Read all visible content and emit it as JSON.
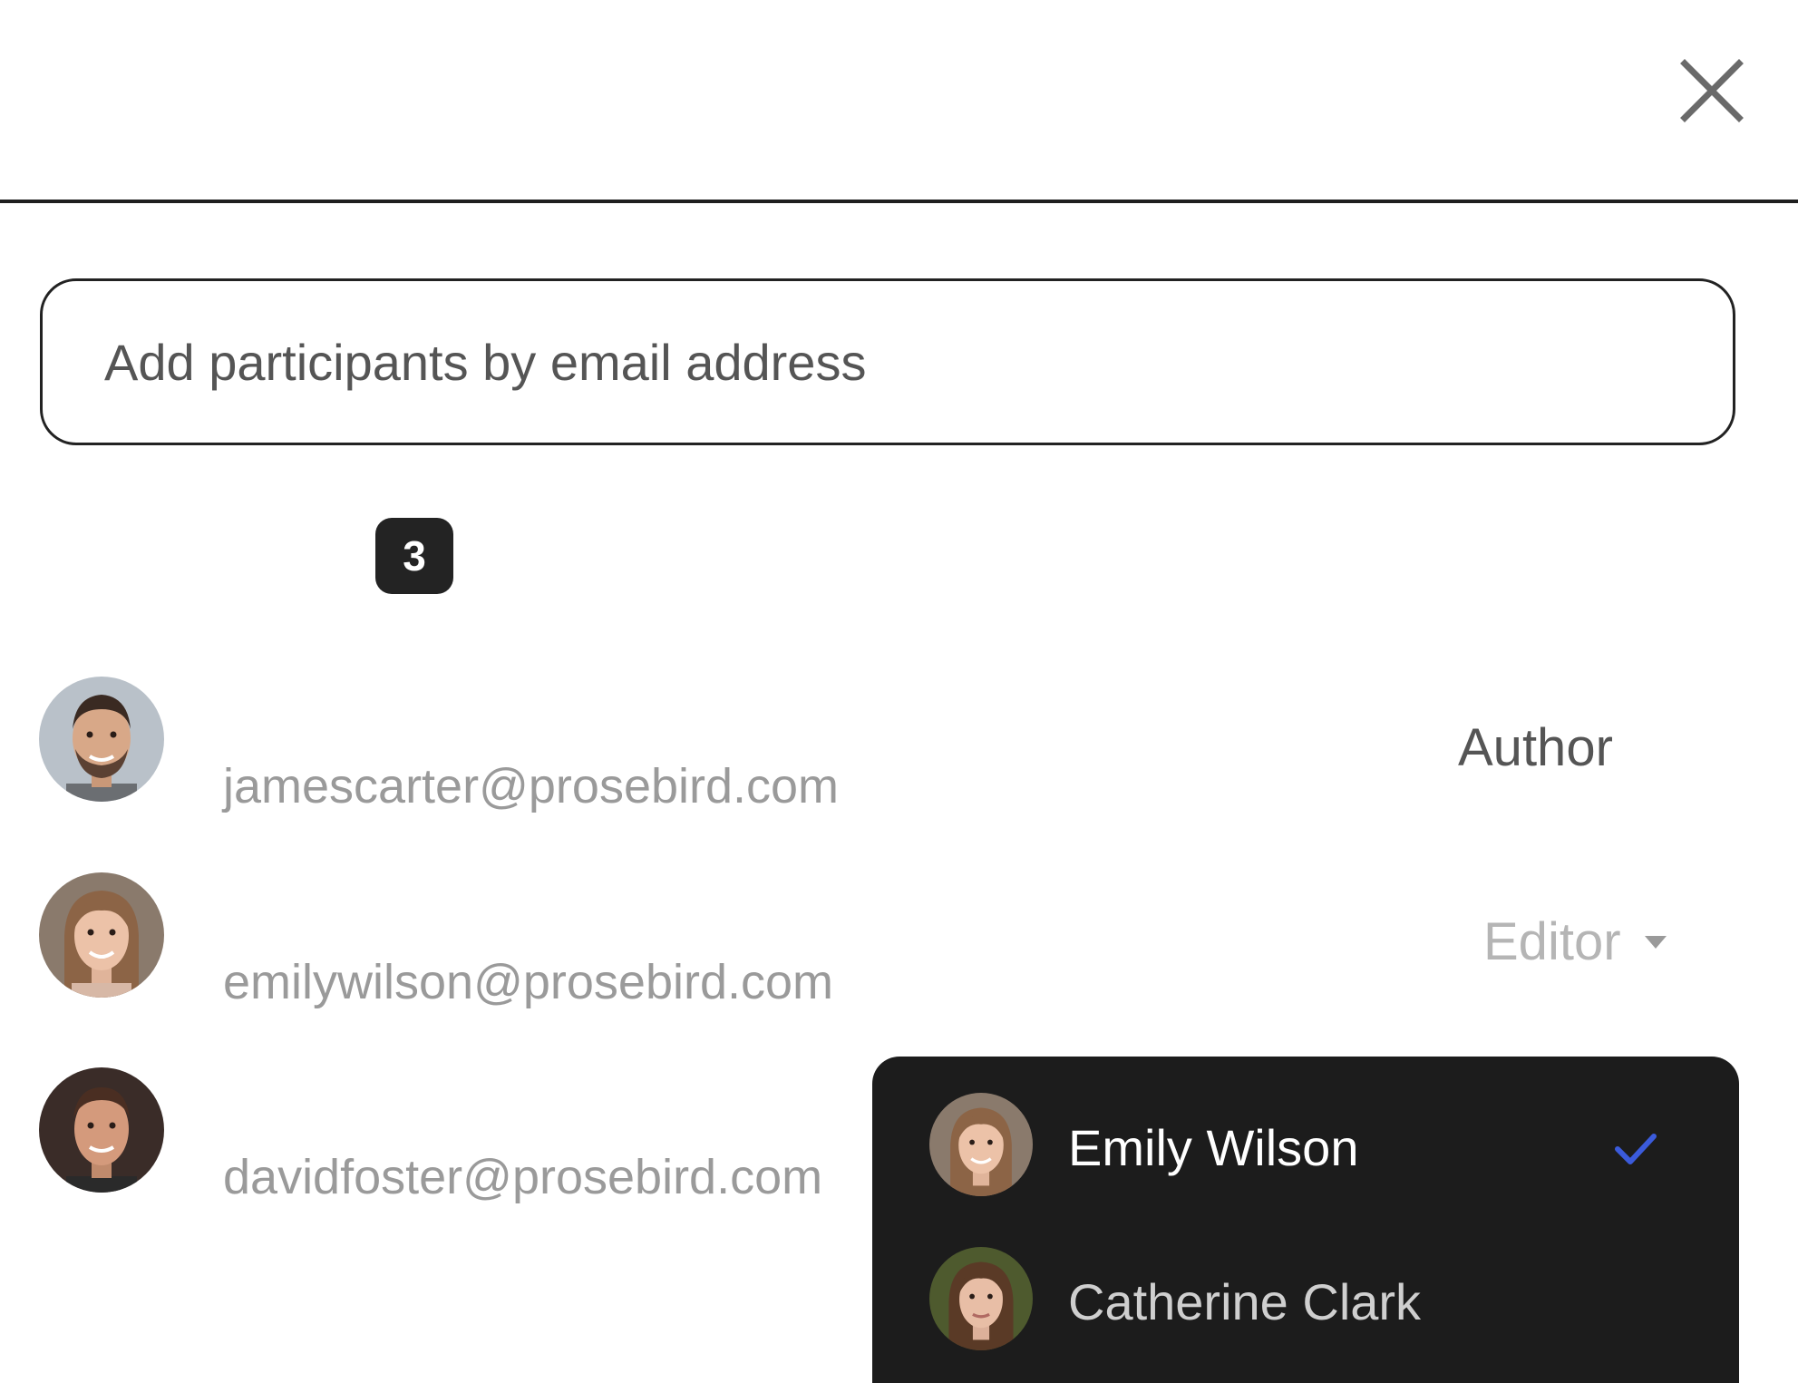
{
  "close": {
    "icon": "close-icon"
  },
  "search": {
    "placeholder": "Add participants by email address",
    "value": ""
  },
  "participants": {
    "count": "3",
    "items": [
      {
        "email": "jamescarter@prosebird.com",
        "role": "Author"
      },
      {
        "email": "emilywilson@prosebird.com",
        "role": "Editor"
      },
      {
        "email": "davidfoster@prosebird.com"
      }
    ]
  },
  "role_menu": {
    "items": [
      {
        "name": "Emily Wilson",
        "selected": true
      },
      {
        "name": "Catherine Clark",
        "selected": false
      }
    ]
  },
  "colors": {
    "menu_bg": "#1c1c1c",
    "checkmark": "#3b5bdb",
    "badge_bg": "#232323"
  }
}
